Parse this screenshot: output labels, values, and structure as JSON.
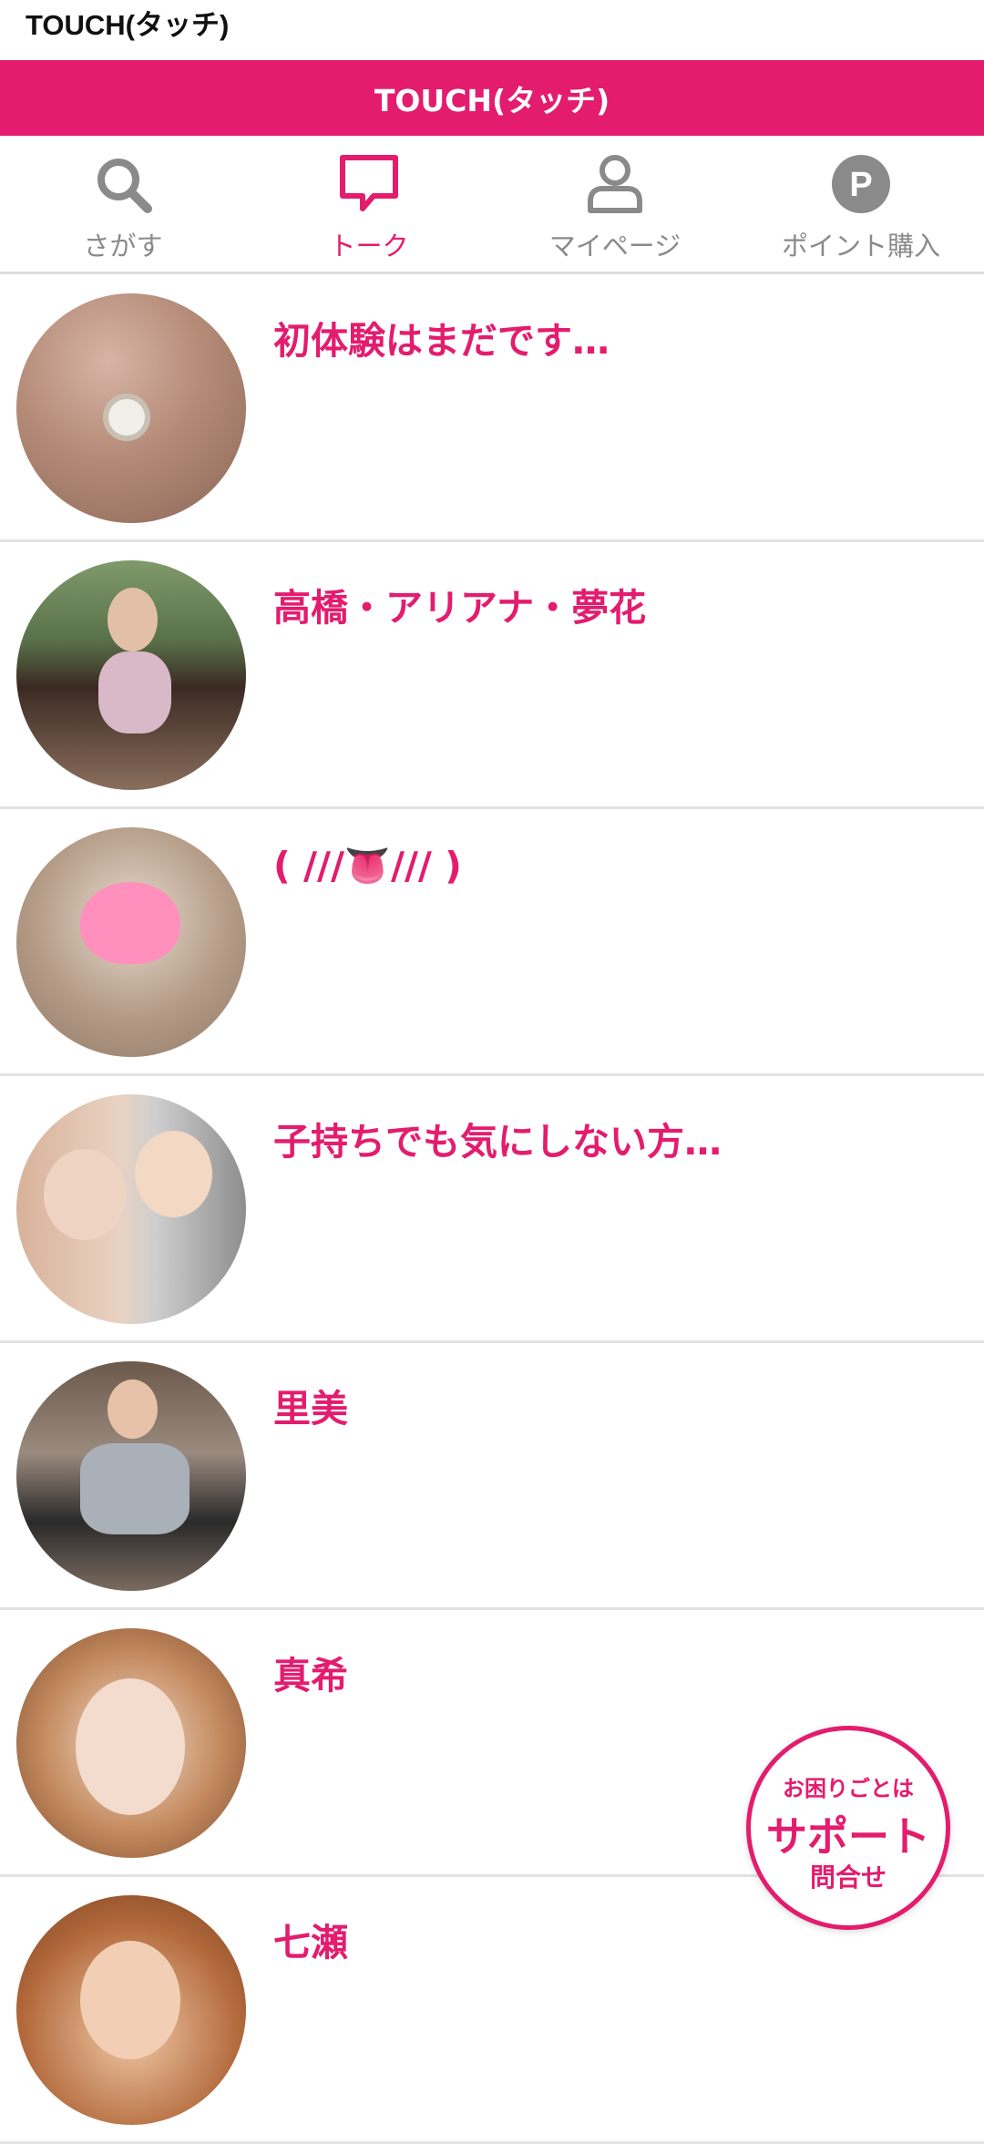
{
  "app_title": "TOUCH(タッチ)",
  "header": {
    "title": "TOUCH(タッチ)"
  },
  "nav": [
    {
      "label": "さがす",
      "icon": "search-icon",
      "active": false
    },
    {
      "label": "トーク",
      "icon": "chat-bubble-icon",
      "active": true
    },
    {
      "label": "マイページ",
      "icon": "user-icon",
      "active": false
    },
    {
      "label": "ポイント購入",
      "icon": "points-p-icon",
      "active": false
    }
  ],
  "talk_list": [
    {
      "name": "初体験はまだです…"
    },
    {
      "name": "高橋・アリアナ・夢花"
    },
    {
      "name": "( ///👅/// )"
    },
    {
      "name": "子持ちでも気にしない方…"
    },
    {
      "name": "里美"
    },
    {
      "name": "真希"
    },
    {
      "name": "七瀬"
    }
  ],
  "support": {
    "line1": "お困りごとは",
    "line2": "サポート",
    "line3": "問合せ"
  },
  "colors": {
    "accent": "#e31c6e",
    "nav_inactive": "#8a8a8a",
    "divider": "#e2e2e2"
  }
}
